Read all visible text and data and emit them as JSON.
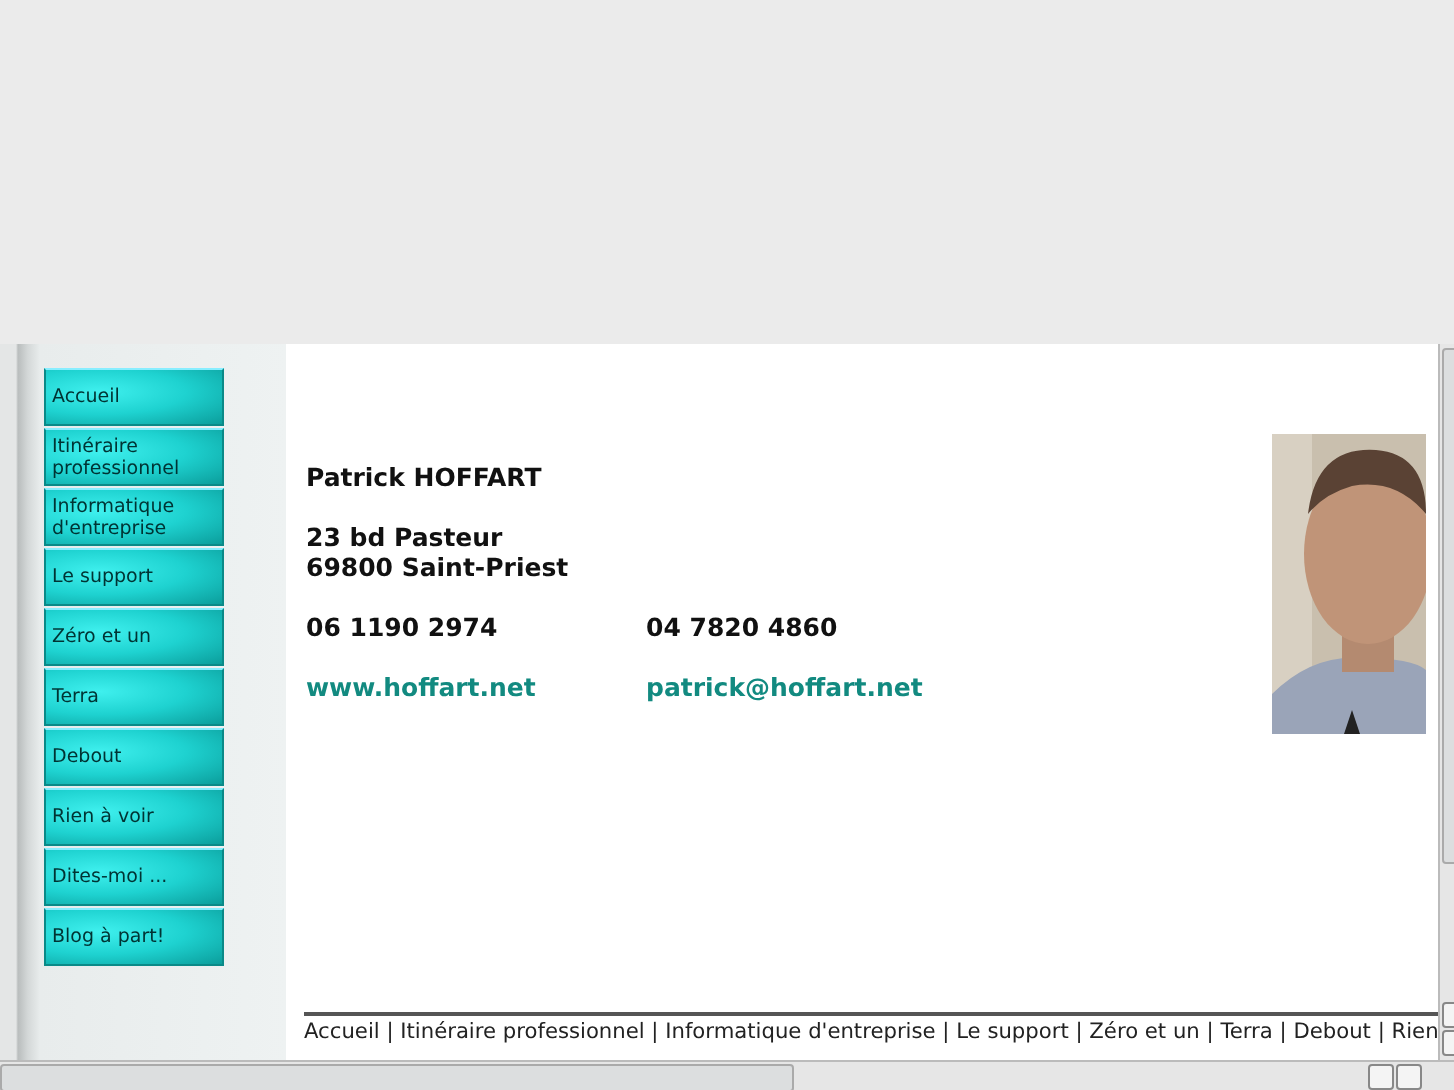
{
  "sidebar": {
    "items": [
      {
        "label": "Accueil"
      },
      {
        "label": "Itinéraire professionnel"
      },
      {
        "label": "Informatique d'entreprise"
      },
      {
        "label": "Le support"
      },
      {
        "label": "Zéro et un"
      },
      {
        "label": "Terra"
      },
      {
        "label": "Debout"
      },
      {
        "label": "Rien à voir"
      },
      {
        "label": "Dites-moi ..."
      },
      {
        "label": "Blog à part!"
      }
    ]
  },
  "contact": {
    "name": "Patrick HOFFART",
    "address": [
      "23 bd Pasteur",
      "69800 Saint-Priest"
    ],
    "phones": [
      "06 1190 2974",
      "04 7820 4860"
    ],
    "website": "www.hoffart.net",
    "email": "patrick@hoffart.net"
  },
  "footer": {
    "nav": "Accueil | Itinéraire professionnel | Informatique d'entreprise | Le support | Zéro et un | Terra | Debout | Rien"
  }
}
